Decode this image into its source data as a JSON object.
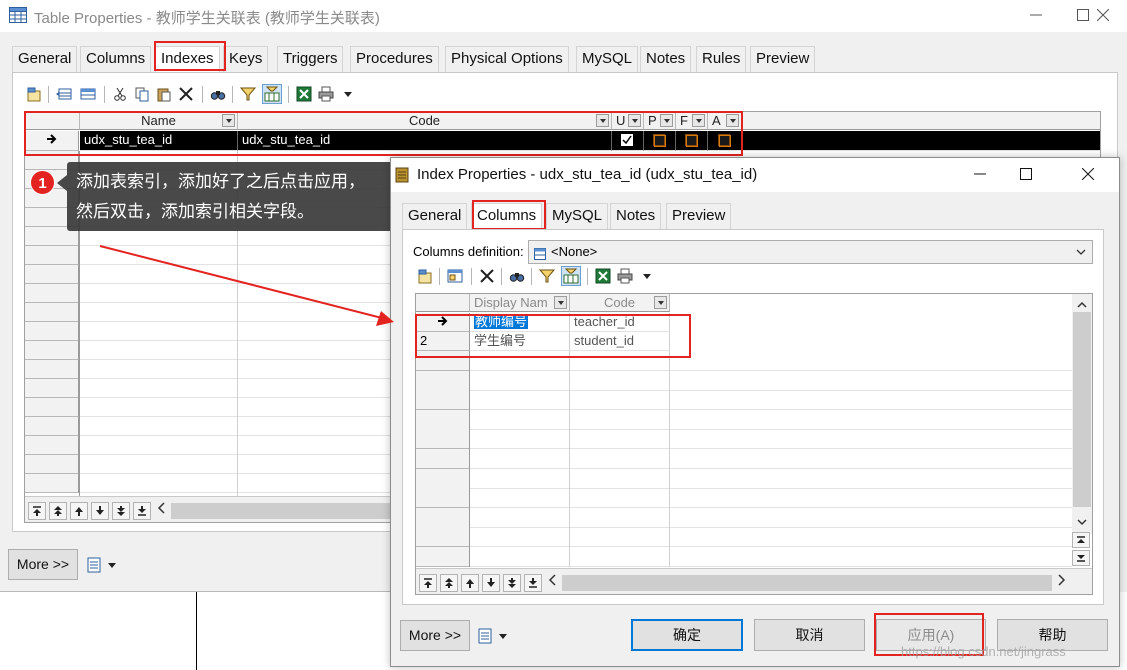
{
  "outer_window": {
    "title": "Table Properties - 教师学生关联表 (教师学生关联表)",
    "tabs": [
      "General",
      "Columns",
      "Indexes",
      "Keys",
      "Triggers",
      "Procedures",
      "Physical Options",
      "MySQL",
      "Notes",
      "Rules",
      "Preview"
    ],
    "active_tab": "Indexes",
    "grid": {
      "columns": [
        "Name",
        "Code",
        "U",
        "P",
        "F",
        "A"
      ],
      "rows": [
        {
          "name": "udx_stu_tea_id",
          "code": "udx_stu_tea_id",
          "unique": true,
          "primary": false,
          "foreign": false,
          "alternate": false
        }
      ]
    },
    "more_button": "More >>"
  },
  "annotation": {
    "badge": "1",
    "line1": "添加表索引，添加好了之后点击应用，",
    "line2": "然后双击，添加索引相关字段。"
  },
  "dialog": {
    "title": "Index Properties - udx_stu_tea_id (udx_stu_tea_id)",
    "tabs": [
      "General",
      "Columns",
      "MySQL",
      "Notes",
      "Preview"
    ],
    "active_tab": "Columns",
    "columns_definition_label": "Columns definition:",
    "columns_definition_value": "<None>",
    "grid": {
      "columns": [
        "Display Nam",
        "Code"
      ],
      "rows": [
        {
          "marker": "→",
          "display_name": "教师编号",
          "code": "teacher_id"
        },
        {
          "marker": "2",
          "display_name": "学生编号",
          "code": "student_id"
        }
      ]
    },
    "buttons": {
      "more": "More >>",
      "ok": "确定",
      "cancel": "取消",
      "apply": "应用(A)",
      "help": "帮助"
    }
  },
  "watermark": "https://blog.csdn.net/jingrass",
  "colors": {
    "highlight_red": "#e3231f",
    "selection_blue": "#0078d7",
    "row_selected_bg": "#000000"
  }
}
